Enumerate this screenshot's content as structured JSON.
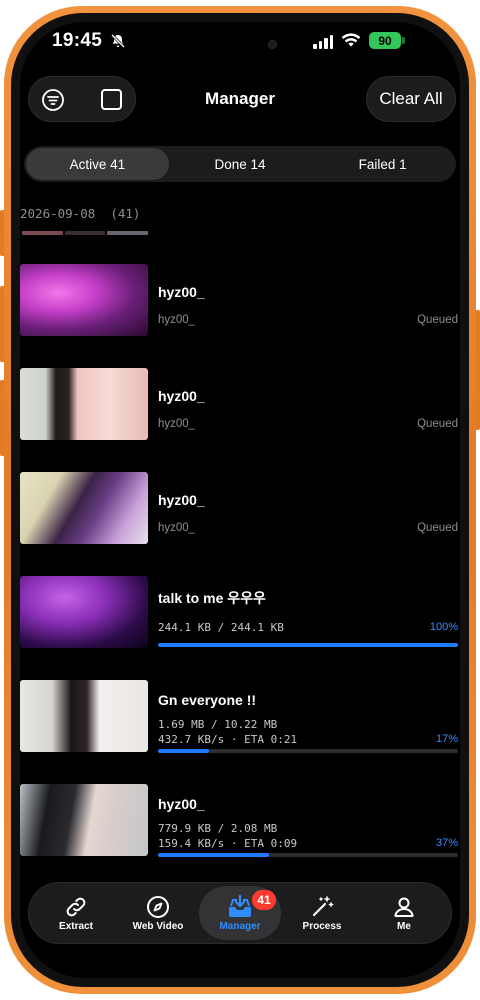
{
  "status_bar": {
    "time": "19:45",
    "battery": "90",
    "icons": [
      "bell-off-icon",
      "cellular-signal-icon",
      "wifi-icon",
      "battery-icon"
    ]
  },
  "header": {
    "title": "Manager",
    "clear_label": "Clear All",
    "icons": [
      "filter-icon",
      "select-all-checkbox-icon"
    ]
  },
  "segments": [
    {
      "label": "Active 41",
      "active": true
    },
    {
      "label": "Done 14",
      "active": false
    },
    {
      "label": "Failed 1",
      "active": false
    }
  ],
  "date_group": {
    "date": "2026-09-08",
    "count": "(41)"
  },
  "items": [
    {
      "title": "hyz00_",
      "subtitle": "hyz00_",
      "status": "Queued"
    },
    {
      "title": "hyz00_",
      "subtitle": "hyz00_",
      "status": "Queued"
    },
    {
      "title": "hyz00_",
      "subtitle": "hyz00_",
      "status": "Queued"
    },
    {
      "title": "talk to me 우우우",
      "size": "244.1 KB / 244.1 KB",
      "percent": "100%",
      "progress": 1.0
    },
    {
      "title": "Gn everyone !!",
      "size": "1.69 MB / 10.22 MB",
      "speed": "432.7 KB/s · ETA 0:21",
      "percent": "17%",
      "progress": 0.17
    },
    {
      "title": "hyz00_",
      "size": "779.9 KB / 2.08 MB",
      "speed": "159.4 KB/s · ETA 0:09",
      "percent": "37%",
      "progress": 0.37
    }
  ],
  "tabbar": {
    "tabs": [
      {
        "label": "Extract",
        "icon": "link-icon"
      },
      {
        "label": "Web Video",
        "icon": "compass-icon"
      },
      {
        "label": "Manager",
        "icon": "download-tray-icon",
        "active": true,
        "badge": "41"
      },
      {
        "label": "Process",
        "icon": "magic-wand-icon"
      },
      {
        "label": "Me",
        "icon": "person-icon"
      }
    ]
  },
  "colors": {
    "accent": "#1f7aff",
    "badge": "#ff3b30",
    "battery": "#33c759",
    "frame": "#e27a26"
  }
}
